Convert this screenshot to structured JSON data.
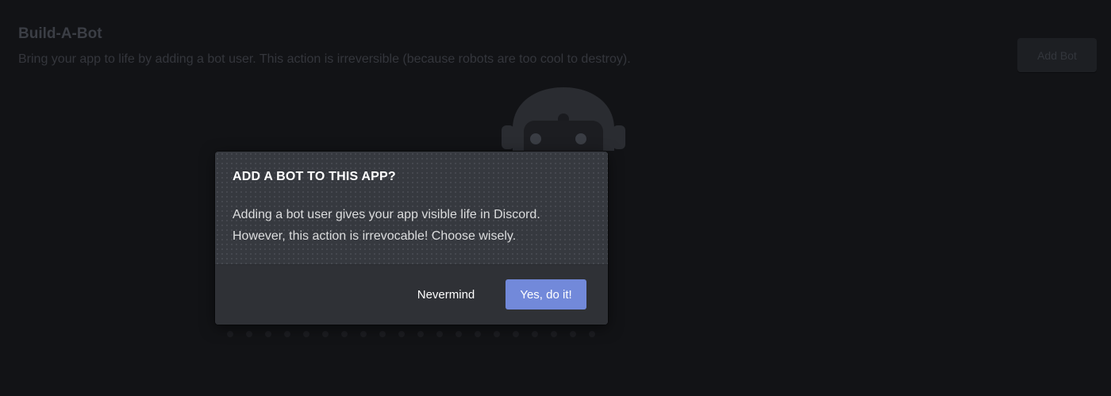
{
  "section": {
    "title": "Build-A-Bot",
    "description": "Bring your app to life by adding a bot user. This action is irreversible (because robots are too cool to destroy)."
  },
  "toolbar": {
    "add_bot_label": "Add Bot"
  },
  "illustration": {
    "icon": "robot-icon"
  },
  "modal": {
    "title": "ADD A BOT TO THIS APP?",
    "body_line1": "Adding a bot user gives your app visible life in Discord.",
    "body_line2": "However, this action is irrevocable! Choose wisely.",
    "cancel_label": "Nevermind",
    "confirm_label": "Yes, do it!"
  },
  "colors": {
    "background": "#121316",
    "modal_background": "#36393f",
    "modal_footer": "#2f3136",
    "accent": "#7289da"
  }
}
